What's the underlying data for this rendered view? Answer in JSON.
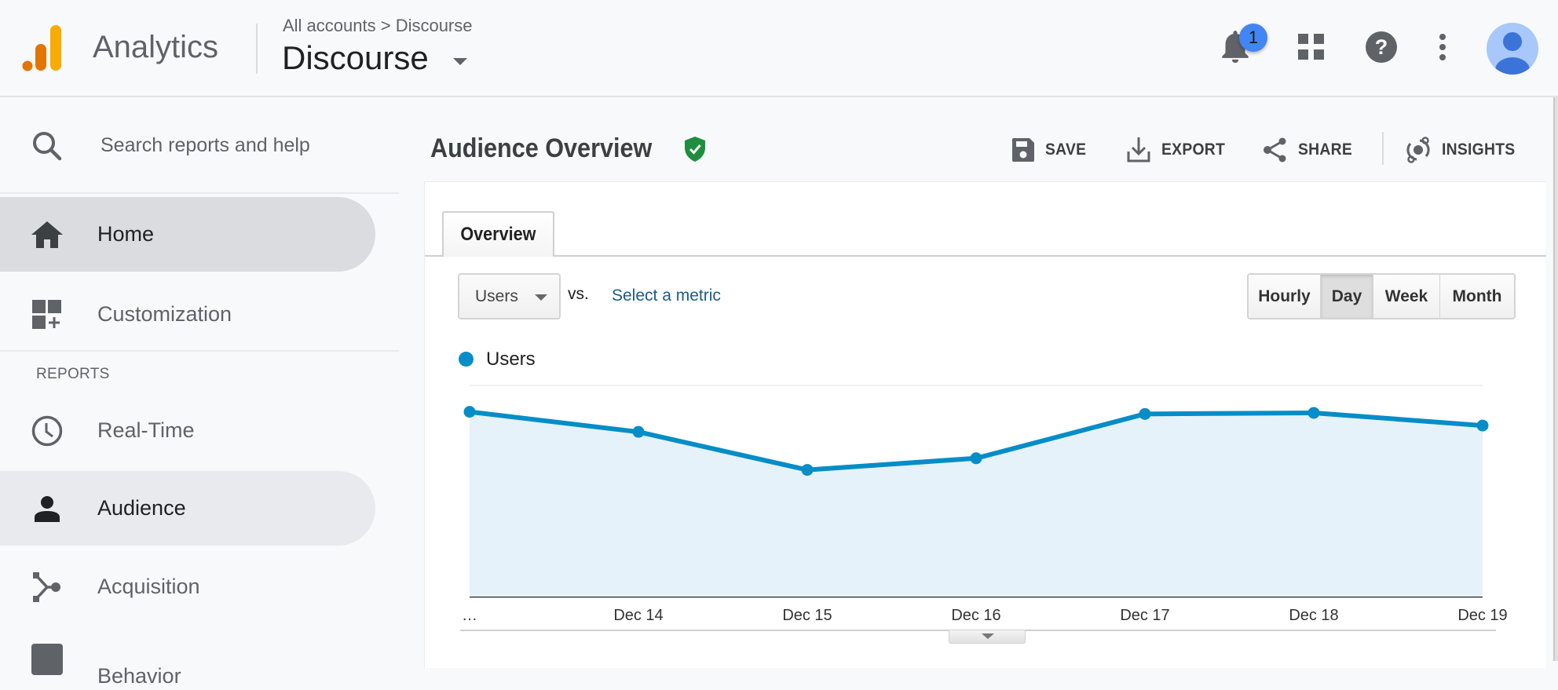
{
  "header": {
    "app_name": "Analytics",
    "breadcrumb": "All accounts > Discourse",
    "property_name": "Discourse",
    "notification_count": "1",
    "icons": [
      "notifications-bell-icon",
      "apps-grid-icon",
      "help-icon",
      "more-vert-icon",
      "account-avatar-icon"
    ]
  },
  "sidebar": {
    "search_placeholder": "Search reports and help",
    "top_items": [
      {
        "label": "Home",
        "icon": "home-icon",
        "active": true
      },
      {
        "label": "Customization",
        "icon": "customization-icon",
        "active": false
      }
    ],
    "section_label": "REPORTS",
    "report_items": [
      {
        "label": "Real-Time",
        "icon": "clock-icon",
        "active": false
      },
      {
        "label": "Audience",
        "icon": "person-icon",
        "active": true
      },
      {
        "label": "Acquisition",
        "icon": "acquisition-icon",
        "active": false
      },
      {
        "label": "Behavior",
        "icon": "behavior-icon",
        "active": false
      }
    ]
  },
  "main": {
    "title": "Audience Overview",
    "title_badge_icon": "verified-shield-icon",
    "actions": [
      {
        "label": "SAVE",
        "icon": "save-icon"
      },
      {
        "label": "EXPORT",
        "icon": "export-icon"
      },
      {
        "label": "SHARE",
        "icon": "share-icon"
      },
      {
        "label": "INSIGHTS",
        "icon": "insights-icon"
      }
    ],
    "tabs": [
      {
        "label": "Overview",
        "active": true
      }
    ],
    "metric_selector": {
      "value": "Users",
      "vs_label": "vs.",
      "compare_link": "Select a metric"
    },
    "granularity": {
      "options": [
        "Hourly",
        "Day",
        "Week",
        "Month"
      ],
      "selected": "Day"
    },
    "legend": {
      "label": "Users",
      "color": "#058dc7"
    }
  },
  "chart_data": {
    "type": "area",
    "title": "",
    "xlabel": "",
    "ylabel": "",
    "categories": [
      "…",
      "Dec 14",
      "Dec 15",
      "Dec 16",
      "Dec 17",
      "Dec 18",
      "Dec 19"
    ],
    "series": [
      {
        "name": "Users",
        "values": [
          1.75,
          1.56,
          1.2,
          1.31,
          1.73,
          1.74,
          1.62
        ],
        "color": "#058dc7",
        "fill": "#e6f2fa"
      }
    ],
    "ylim": [
      0,
      2
    ],
    "y_gridlines": [
      1,
      2
    ],
    "y_tick_labels_visible": false,
    "value_units": "relative to unlabeled gridlines (no y-axis values shown)",
    "grid": true,
    "legend": "top-left"
  }
}
